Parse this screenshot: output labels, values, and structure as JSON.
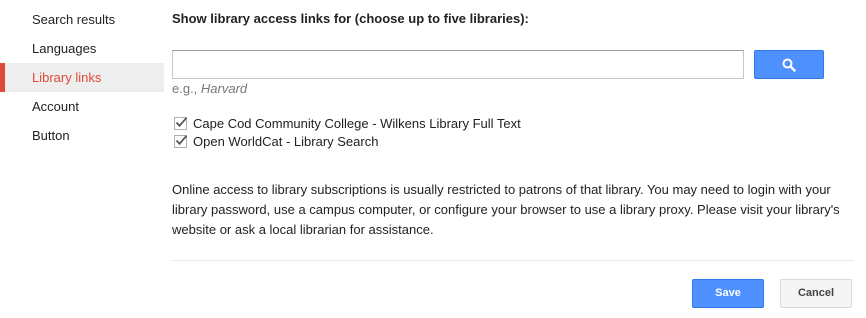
{
  "sidebar": {
    "items": [
      {
        "label": "Search results",
        "active": false
      },
      {
        "label": "Languages",
        "active": false
      },
      {
        "label": "Library links",
        "active": true
      },
      {
        "label": "Account",
        "active": false
      },
      {
        "label": "Button",
        "active": false
      }
    ]
  },
  "main": {
    "heading": "Show library access links for (choose up to five libraries):",
    "search": {
      "value": "",
      "placeholder": "",
      "button_icon": "search-icon"
    },
    "hint": {
      "prefix": "e.g., ",
      "example": "Harvard"
    },
    "libraries": [
      {
        "label": "Cape Cod Community College - Wilkens Library Full Text",
        "checked": true
      },
      {
        "label": "Open WorldCat - Library Search",
        "checked": true
      }
    ],
    "description": "Online access to library subscriptions is usually restricted to patrons of that library. You may need to login with your library password, use a campus computer, or configure your browser to use a library proxy. Please visit your library's website or ask a local librarian for assistance.",
    "buttons": {
      "save_label": "Save",
      "cancel_label": "Cancel"
    }
  },
  "colors": {
    "accent_red": "#dd4b39",
    "primary_blue": "#4d90fe",
    "primary_blue_border": "#3079ed"
  }
}
